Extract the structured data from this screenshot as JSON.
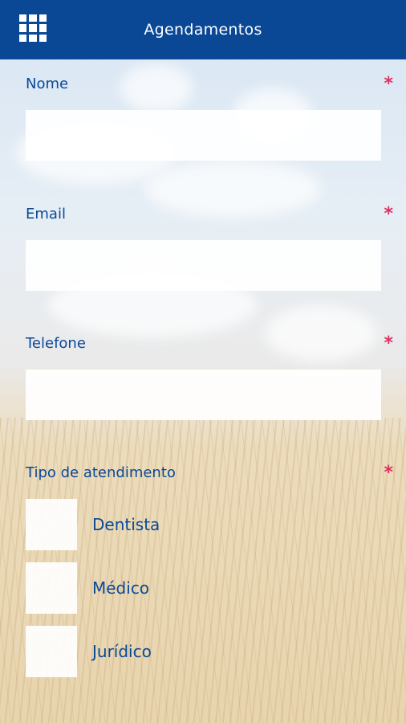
{
  "header": {
    "title": "Agendamentos",
    "menu_icon": "grid-menu-icon"
  },
  "form": {
    "required_mark": "*",
    "fields": [
      {
        "label": "Nome",
        "value": "",
        "placeholder": ""
      },
      {
        "label": "Email",
        "value": "",
        "placeholder": ""
      },
      {
        "label": "Telefone",
        "value": "",
        "placeholder": ""
      }
    ],
    "service_type": {
      "label": "Tipo de atendimento",
      "options": [
        {
          "label": "Dentista",
          "checked": false
        },
        {
          "label": "Médico",
          "checked": false
        },
        {
          "label": "Jurídico",
          "checked": false
        }
      ]
    }
  },
  "colors": {
    "header_bg": "#0a4896",
    "label": "#0a4896",
    "required": "#e03060"
  }
}
